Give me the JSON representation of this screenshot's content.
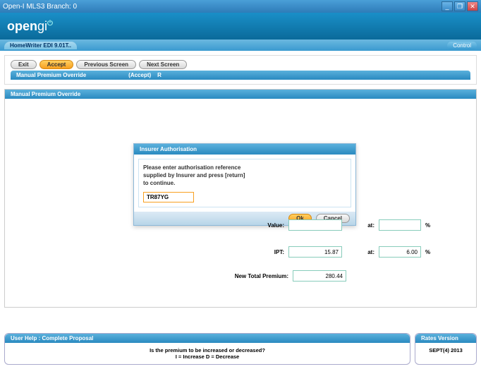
{
  "window": {
    "title": "Open-I MLS3 Branch: 0"
  },
  "tabs": {
    "main": "HomeWriter EDI 9.01T..",
    "control": "Control"
  },
  "toolbar": {
    "exit": "Exit",
    "accept": "Accept",
    "previous": "Previous Screen",
    "next": "Next Screen",
    "sub_title": "Manual Premium Override",
    "sub_hint": "(Accept)",
    "sub_key": "R"
  },
  "panel": {
    "title": "Manual Premium Override"
  },
  "dialog": {
    "title": "Insurer Authorisation",
    "msg1": "Please enter authorisation reference",
    "msg2": "supplied by Insurer and press [return]",
    "msg3": "to continue.",
    "input": "TR87YG",
    "ok": "Ok",
    "cancel": "Cancel"
  },
  "fields": {
    "value_lbl": "Value:",
    "value": "",
    "at1_lbl": "at:",
    "at1": "",
    "pct": "%",
    "ipt_lbl": "IPT:",
    "ipt": "15.87",
    "at2_lbl": "at:",
    "at2": "6.00",
    "ntp_lbl": "New Total Premium:",
    "ntp": "280.44"
  },
  "help": {
    "title": "User Help : Complete Proposal",
    "line1": "Is the premium to be increased or decreased?",
    "line2": "I = Increase    D = Decrease"
  },
  "rates": {
    "title": "Rates Version",
    "value": "SEPT(4) 2013"
  }
}
